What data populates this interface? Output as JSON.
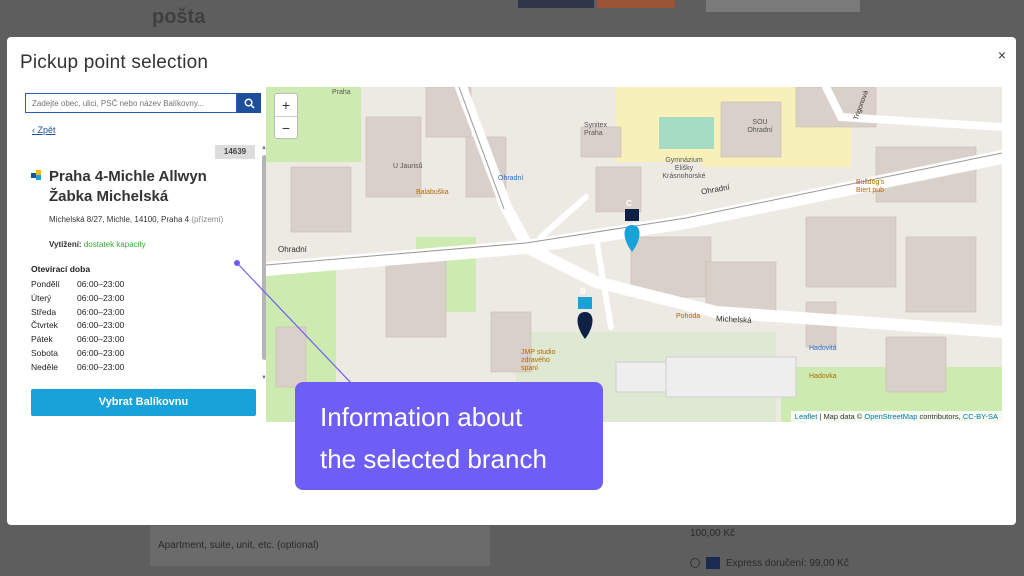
{
  "background_page": {
    "title": "pošta",
    "address_placeholder": "Apartment, suite, unit, etc. (optional)",
    "shipping_price": "100,00 Kč",
    "express_label": "Express doručení: 99,00 Kč"
  },
  "modal": {
    "title": "Pickup point selection",
    "close": "×"
  },
  "search": {
    "placeholder": "Zadejte obec, ulici, PSČ nebo název Balíkovny..."
  },
  "back": {
    "label": "Zpět"
  },
  "branch": {
    "id": "14639",
    "name": "Praha 4-Michle Allwyn Žabka Michelská",
    "address": "Michelská 8/27, Michle, 14100, Praha 4",
    "address_note": "(přízemí)",
    "capacity_label": "Vytížení:",
    "capacity_value": "dostatek kapacity",
    "hours_title": "Otevírací doba",
    "hours": [
      {
        "day": "Pondělí",
        "time": "06:00–23:00"
      },
      {
        "day": "Úterý",
        "time": "06:00–23:00"
      },
      {
        "day": "Středa",
        "time": "06:00–23:00"
      },
      {
        "day": "Čtvrtek",
        "time": "06:00–23:00"
      },
      {
        "day": "Pátek",
        "time": "06:00–23:00"
      },
      {
        "day": "Sobota",
        "time": "06:00–23:00"
      },
      {
        "day": "Neděle",
        "time": "06:00–23:00"
      }
    ]
  },
  "select_button": {
    "label": "Vybrat Balíkovnu"
  },
  "map": {
    "zoom_in": "+",
    "zoom_out": "−",
    "labels": {
      "praha": "Praha",
      "synitex": "Synitex Praha",
      "sou": "SOU Ohradní",
      "gymnazium": "Gymnázium Elišky Krásnohorské",
      "u_jaurisu": "U Jaurisů",
      "balabuska": "Balabuška",
      "ohradni_stop": "Ohradní",
      "bulldogs": "Bulldog's Biert pub",
      "pohoda": "Pohoda",
      "jmp": "JMP studio zdravého spaní",
      "hadovita_stop": "Hadovitá",
      "hadovka": "Hadovka",
      "street_ohradni": "Ohradní",
      "street_michelska": "Michelská",
      "street_trigonova": "Trigonová"
    },
    "markers": [
      "C",
      "B"
    ],
    "attribution_leaflet": "Leaflet",
    "attribution_text": "| Map data ©",
    "attribution_osm": "OpenStreetMap",
    "attribution_contrib": "contributors,",
    "attribution_license": "CC-BY-SA"
  },
  "callout": {
    "line1": "Information about",
    "line2": "the selected branch"
  },
  "colors": {
    "accent": "#17a3da",
    "callout": "#6f5ef5",
    "brand_blue": "#1d4f9a",
    "capacity_ok": "#3aaa35"
  }
}
